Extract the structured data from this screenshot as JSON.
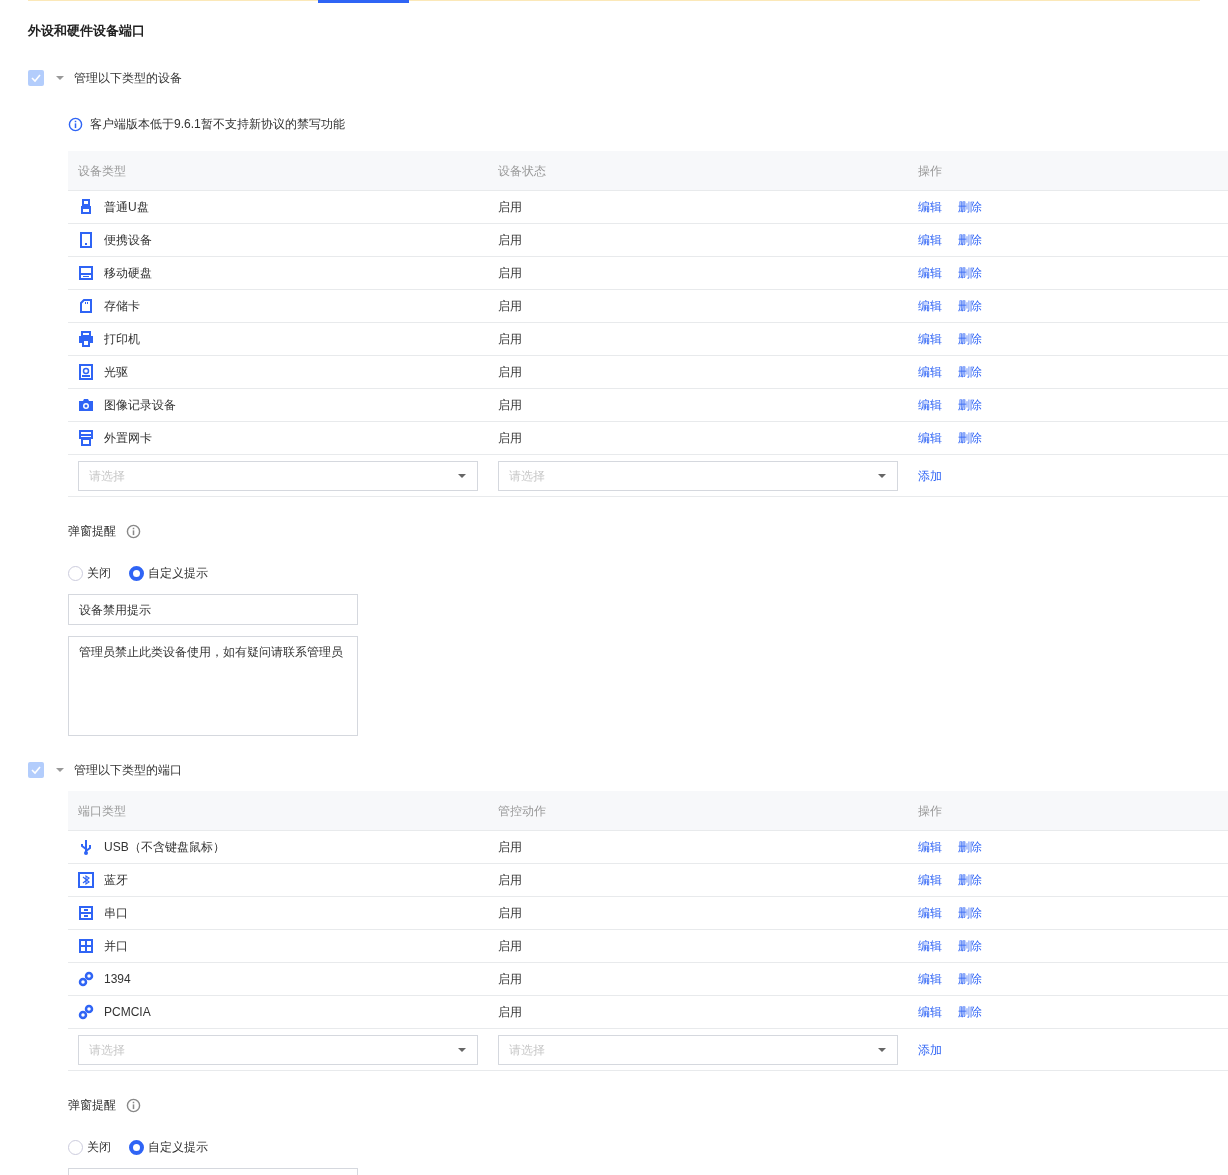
{
  "page_title": "外设和硬件设备端口",
  "sections": [
    {
      "checked": true,
      "disabled": true,
      "expanded": true,
      "label": "管理以下类型的设备",
      "notice": "客户端版本低于9.6.1暂不支持新协议的禁写功能",
      "table": {
        "columns": [
          "设备类型",
          "设备状态",
          "操作"
        ],
        "rows": [
          {
            "type": "普通U盘",
            "status": "启用",
            "actions": [
              "编辑",
              "删除"
            ]
          },
          {
            "type": "便携设备",
            "status": "启用",
            "actions": [
              "编辑",
              "删除"
            ]
          },
          {
            "type": "移动硬盘",
            "status": "启用",
            "actions": [
              "编辑",
              "删除"
            ]
          },
          {
            "type": "存储卡",
            "status": "启用",
            "actions": [
              "编辑",
              "删除"
            ]
          },
          {
            "type": "打印机",
            "status": "启用",
            "actions": [
              "编辑",
              "删除"
            ]
          },
          {
            "type": "光驱",
            "status": "启用",
            "actions": [
              "编辑",
              "删除"
            ]
          },
          {
            "type": "图像记录设备",
            "status": "启用",
            "actions": [
              "编辑",
              "删除"
            ]
          },
          {
            "type": "外置网卡",
            "status": "启用",
            "actions": [
              "编辑",
              "删除"
            ]
          }
        ],
        "new_row": {
          "selects": [
            {
              "placeholder": "请选择"
            },
            {
              "placeholder": "请选择"
            }
          ],
          "add": "添加"
        }
      },
      "popup": {
        "label": "弹窗提醒",
        "options": [
          {
            "label": "关闭",
            "selected": false
          },
          {
            "label": "自定义提示",
            "selected": true
          }
        ],
        "title_field": {
          "value": "设备禁用提示"
        },
        "message_field": {
          "value": "管理员禁止此类设备使用，如有疑问请联系管理员"
        }
      }
    },
    {
      "checked": true,
      "disabled": true,
      "expanded": true,
      "label": "管理以下类型的端口",
      "table": {
        "columns": [
          "端口类型",
          "管控动作",
          "操作"
        ],
        "rows": [
          {
            "type": "USB（不含键盘鼠标）",
            "status": "启用",
            "actions": [
              "编辑",
              "删除"
            ]
          },
          {
            "type": "蓝牙",
            "status": "启用",
            "actions": [
              "编辑",
              "删除"
            ]
          },
          {
            "type": "串口",
            "status": "启用",
            "actions": [
              "编辑",
              "删除"
            ]
          },
          {
            "type": "并口",
            "status": "启用",
            "actions": [
              "编辑",
              "删除"
            ]
          },
          {
            "type": "1394",
            "status": "启用",
            "actions": [
              "编辑",
              "删除"
            ]
          },
          {
            "type": "PCMCIA",
            "status": "启用",
            "actions": [
              "编辑",
              "删除"
            ]
          }
        ],
        "new_row": {
          "selects": [
            {
              "placeholder": "请选择"
            },
            {
              "placeholder": "请选择"
            }
          ],
          "add": "添加"
        }
      },
      "popup": {
        "label": "弹窗提醒",
        "options": [
          {
            "label": "关闭",
            "selected": false
          },
          {
            "label": "自定义提示",
            "selected": true
          }
        ]
      }
    }
  ]
}
